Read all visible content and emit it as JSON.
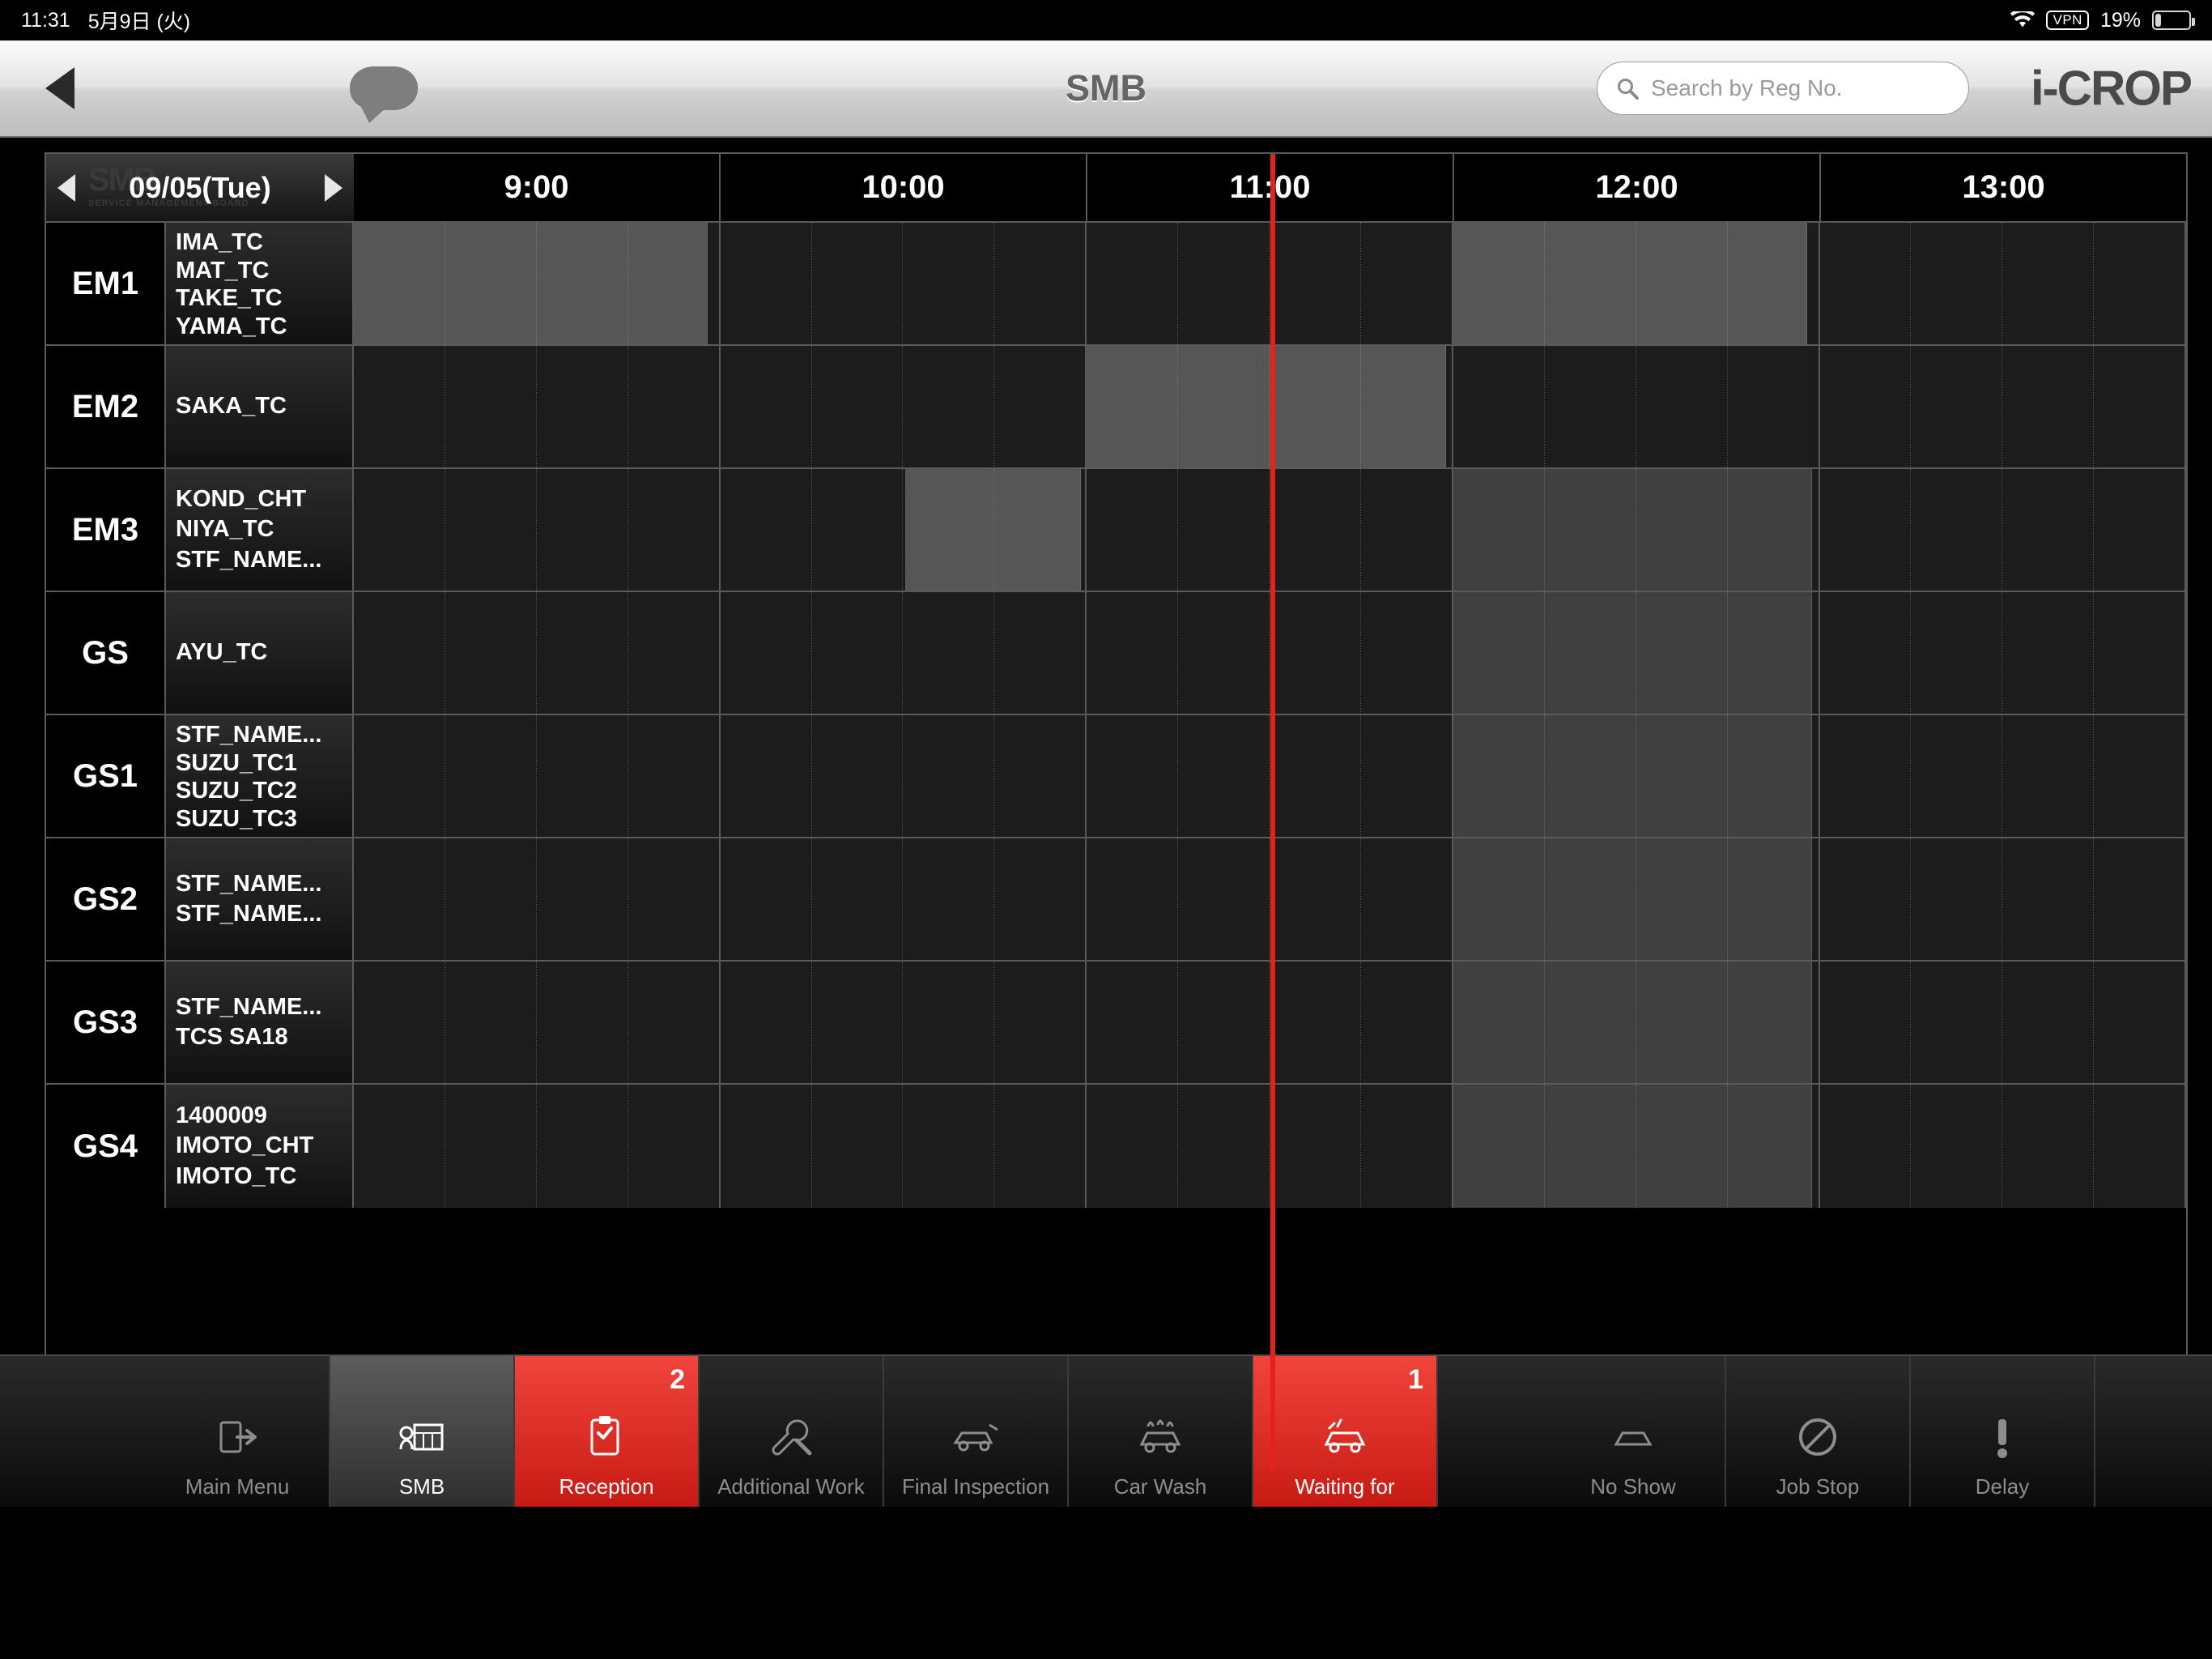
{
  "status_bar": {
    "time": "11:31",
    "date": "5月9日 (火)",
    "vpn": "VPN",
    "battery_percent": "19%"
  },
  "nav": {
    "title": "SMB",
    "brand": "i-CROP",
    "search_placeholder": "Search by Reg No.",
    "search_value": ""
  },
  "scheduler": {
    "date_label": "09/05(Tue)",
    "logo_ghost": "SMB",
    "logo_ghost_sub": "SERVICE MANAGEMENT BOARD",
    "times": [
      "9:00",
      "10:00",
      "11:00",
      "12:00",
      "13:00"
    ],
    "now_line_percent": 50.0,
    "rows": [
      {
        "group": "EM1",
        "names": [
          "IMA_TC",
          "MAT_TC",
          "TAKE_TC",
          "YAMA_TC"
        ],
        "blocks": [
          {
            "left": 0.0,
            "width": 19.3,
            "shade": "light"
          },
          {
            "left": 60.0,
            "width": 19.3,
            "shade": "light"
          }
        ]
      },
      {
        "group": "EM2",
        "names": [
          "SAKA_TC"
        ],
        "blocks": [
          {
            "left": 40.0,
            "width": 19.6,
            "shade": "light"
          }
        ]
      },
      {
        "group": "EM3",
        "names": [
          "KOND_CHT",
          "NIYA_TC",
          "STF_NAME..."
        ],
        "blocks": [
          {
            "left": 30.1,
            "width": 9.6,
            "shade": "light"
          },
          {
            "left": 60.0,
            "width": 19.6,
            "shade": "normal"
          }
        ]
      },
      {
        "group": "GS",
        "names": [
          "AYU_TC"
        ],
        "blocks": [
          {
            "left": 60.0,
            "width": 19.6,
            "shade": "normal"
          }
        ]
      },
      {
        "group": "GS1",
        "names": [
          "STF_NAME...",
          "SUZU_TC1",
          "SUZU_TC2",
          "SUZU_TC3"
        ],
        "blocks": [
          {
            "left": 60.0,
            "width": 19.6,
            "shade": "normal"
          }
        ]
      },
      {
        "group": "GS2",
        "names": [
          "STF_NAME...",
          "STF_NAME..."
        ],
        "blocks": [
          {
            "left": 60.0,
            "width": 19.6,
            "shade": "normal"
          }
        ]
      },
      {
        "group": "GS3",
        "names": [
          "STF_NAME...",
          "TCS SA18"
        ],
        "blocks": [
          {
            "left": 60.0,
            "width": 19.6,
            "shade": "normal"
          }
        ]
      },
      {
        "group": "GS4",
        "names": [
          "1400009",
          "IMOTO_CHT",
          "IMOTO_TC"
        ],
        "blocks": [
          {
            "left": 60.0,
            "width": 19.6,
            "shade": "normal"
          }
        ]
      }
    ]
  },
  "toolbar": {
    "items": [
      {
        "label": "Main Menu",
        "icon": "exit-icon",
        "state": "normal",
        "badge": ""
      },
      {
        "label": "SMB",
        "icon": "board-icon",
        "state": "active",
        "badge": ""
      },
      {
        "label": "Reception",
        "icon": "clipboard-icon",
        "state": "red",
        "badge": "2"
      },
      {
        "label": "Additional Work",
        "icon": "wrench-icon",
        "state": "normal",
        "badge": ""
      },
      {
        "label": "Final Inspection",
        "icon": "inspection-icon",
        "state": "normal",
        "badge": ""
      },
      {
        "label": "Car Wash",
        "icon": "carwash-icon",
        "state": "normal",
        "badge": ""
      },
      {
        "label": "Waiting for",
        "icon": "waiting-icon",
        "state": "red",
        "badge": "1"
      },
      {
        "label": "No Show",
        "icon": "noshow-icon",
        "state": "normal",
        "badge": ""
      },
      {
        "label": "Job Stop",
        "icon": "jobstop-icon",
        "state": "normal",
        "badge": ""
      },
      {
        "label": "Delay",
        "icon": "delay-icon",
        "state": "normal",
        "badge": ""
      }
    ]
  },
  "colors": {
    "accent_red": "#e2231a",
    "panel_border": "#5a5a5a",
    "grid_bg": "#1c1c1c"
  }
}
